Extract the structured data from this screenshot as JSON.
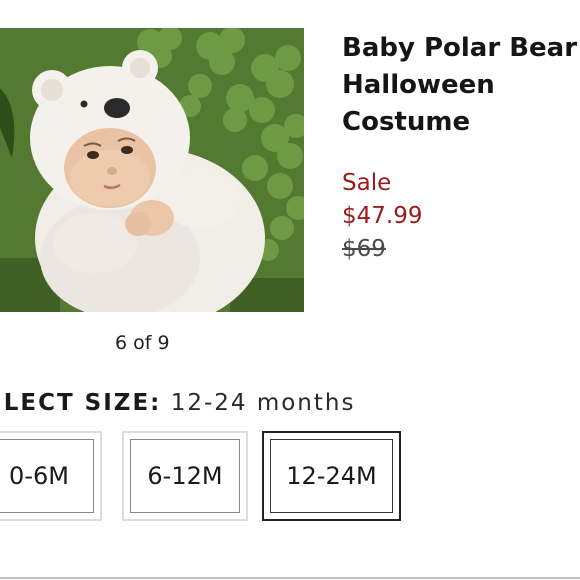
{
  "product": {
    "title": "Baby Polar Bear Halloween Costume",
    "sale_label": "Sale",
    "sale_price": "$47.99",
    "original_price": "$69"
  },
  "gallery": {
    "counter": "6 of 9"
  },
  "size_selector": {
    "label": "ELECT SIZE:",
    "selected_value": "12-24 months",
    "options": [
      {
        "label": "0-6M",
        "selected": false
      },
      {
        "label": "6-12M",
        "selected": false
      },
      {
        "label": "12-24M",
        "selected": true
      }
    ]
  },
  "colors": {
    "sale": "#9b1b1b",
    "text": "#1a1a1a",
    "border_selected": "#222222",
    "border_default": "#dcdcdc"
  }
}
